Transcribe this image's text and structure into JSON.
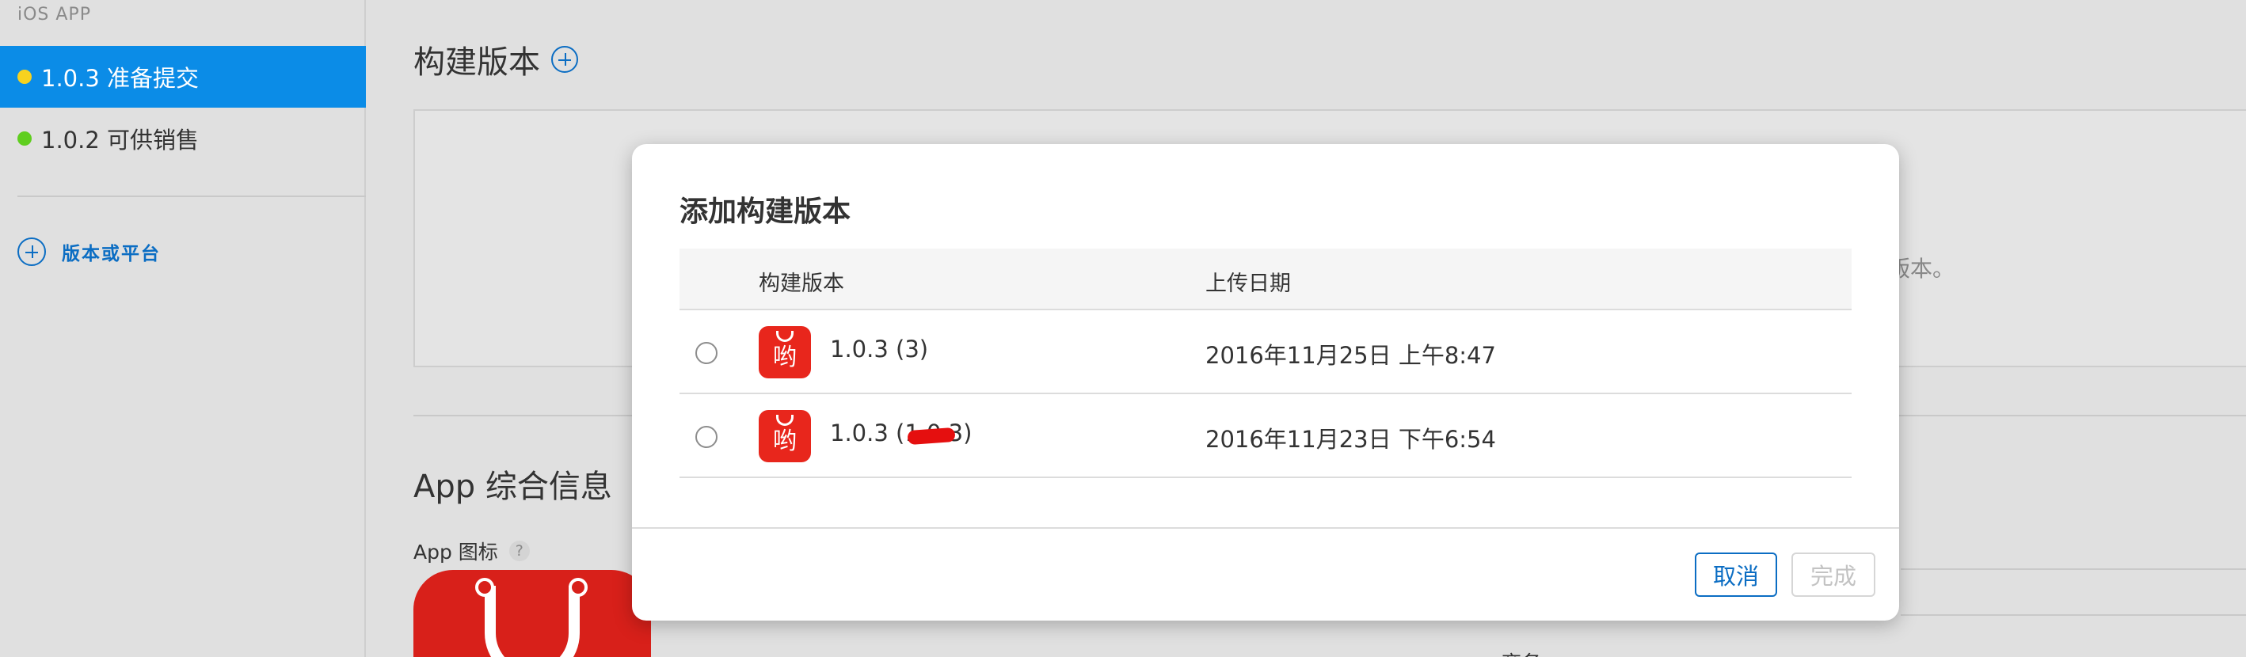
{
  "sidebar": {
    "heading": "iOS APP",
    "versions": [
      {
        "label": "1.0.3 准备提交",
        "status_color": "#f7d21f",
        "active": true
      },
      {
        "label": "1.0.2 可供销售",
        "status_color": "#5fce1f",
        "active": false
      }
    ],
    "add_label": "版本或平台"
  },
  "main": {
    "build_title": "构建版本",
    "build_box_text": "版本。",
    "app_info_title": "App 综合信息",
    "app_icon_label": "App 图标",
    "help_mark": "?",
    "partial_label": "商务"
  },
  "modal": {
    "title": "添加构建版本",
    "columns": {
      "build": "构建版本",
      "date": "上传日期"
    },
    "rows": [
      {
        "build": "1.0.3 (3)",
        "date": "2016年11月25日 上午8:47",
        "icon_char": "哟",
        "redacted": false
      },
      {
        "build": "1.0.3 (1.0.3)",
        "date": "2016年11月23日 下午6:54",
        "icon_char": "哟",
        "redacted": true
      }
    ],
    "cancel_label": "取消",
    "done_label": "完成"
  },
  "colors": {
    "accent": "#0b8ce7",
    "link": "#0b6dc3",
    "brand_red": "#e8261c"
  }
}
